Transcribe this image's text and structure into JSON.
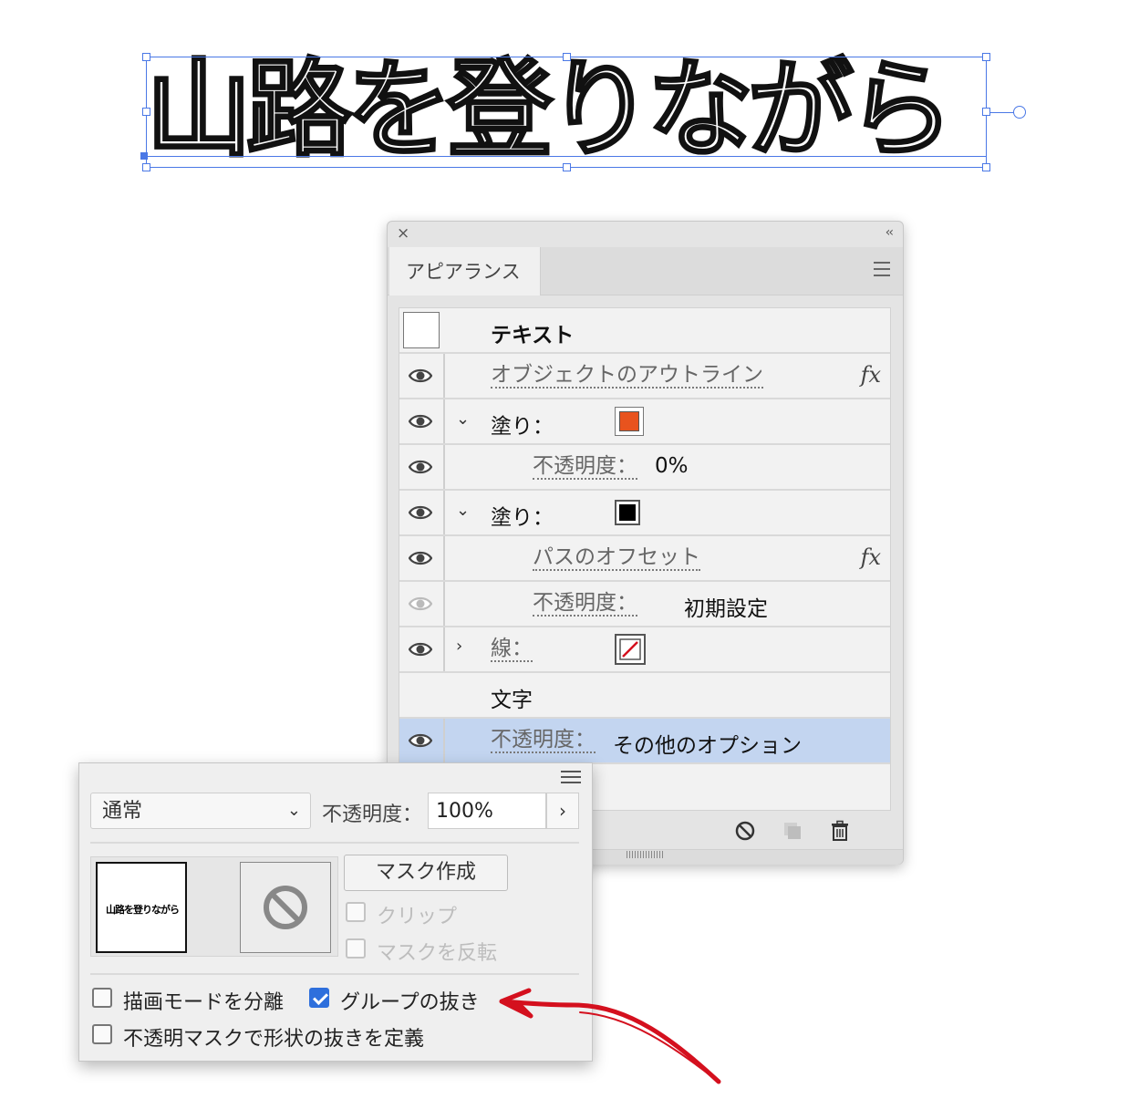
{
  "canvas": {
    "artwork_text": "山路を登りながら"
  },
  "appearance_panel": {
    "close_glyph": "×",
    "collapse_glyph": "‹‹",
    "tab_label": "アピアランス",
    "menu_icon": "hamburger-icon",
    "rows": [
      {
        "label": "テキスト",
        "kind": "header"
      },
      {
        "label": "オブジェクトのアウトライン",
        "fx": "fx",
        "visible": true
      },
      {
        "label": "塗り：",
        "fill_color": "#e8531e",
        "visible": true,
        "expanded": true
      },
      {
        "label": "不透明度：",
        "value": "0%",
        "visible": true
      },
      {
        "label": "塗り：",
        "fill_color": "#000000",
        "visible": true,
        "expanded": true
      },
      {
        "label": "パスのオフセット",
        "fx": "fx",
        "visible": true
      },
      {
        "label": "不透明度：",
        "value": "初期設定",
        "visible": false
      },
      {
        "label": "線：",
        "stroke": "none",
        "visible": true,
        "expanded": false
      },
      {
        "label": "文字"
      },
      {
        "label": "不透明度：",
        "value": "その他のオプション",
        "visible": true,
        "selected": true
      }
    ],
    "footer_icons": [
      "clear-appearance-icon",
      "duplicate-item-icon",
      "trash-icon"
    ]
  },
  "transparency_panel": {
    "menu_icon": "panel-options-icon",
    "blend_mode": "通常",
    "opacity_label": "不透明度：",
    "opacity_value": "100%",
    "stepper_glyph": "›",
    "artwork_thumb_text": "山路を登りながら",
    "mask_button": "マスク作成",
    "clip_label": "クリップ",
    "invert_mask_label": "マスクを反転",
    "isolate_blending_label": "描画モードを分離",
    "isolate_blending_checked": false,
    "knockout_group_label": "グループの抜き",
    "knockout_group_checked": true,
    "opacity_mask_label": "不透明マスクで形状の抜きを定義",
    "opacity_mask_checked": false
  },
  "colors": {
    "selection": "#4a78e6",
    "row_selected": "#c3d5f0",
    "annotation_arrow": "#d4101e",
    "checkbox_checked": "#2e6fdc"
  }
}
